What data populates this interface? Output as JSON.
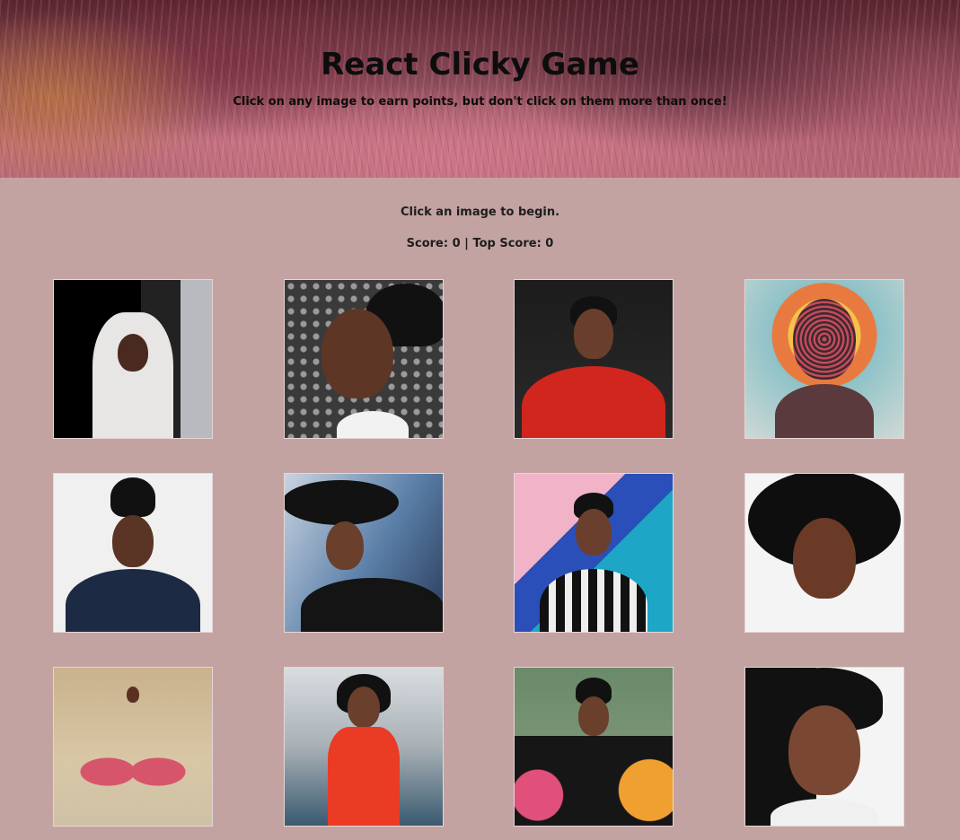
{
  "header": {
    "title": "React Clicky Game",
    "subtitle": "Click on any image to earn points, but don't click on them more than once!"
  },
  "status": {
    "message": "Click an image to begin.",
    "score_line": "Score: 0 | Top Score: 0"
  },
  "colors": {
    "page_background": "#c3a3a2",
    "text": "#1a1a1a"
  },
  "cards": [
    {
      "label": "white-dress-photo"
    },
    {
      "label": "close-up-portrait-photo"
    },
    {
      "label": "red-jacket-photo"
    },
    {
      "label": "beaded-veil-album-art"
    },
    {
      "label": "sunglasses-suit-photo"
    },
    {
      "label": "wide-brim-hat-photo"
    },
    {
      "label": "colorful-wall-photo"
    },
    {
      "label": "jeweled-cap-photo"
    },
    {
      "label": "desert-pink-dress-photo"
    },
    {
      "label": "red-coat-rocket-photo"
    },
    {
      "label": "muppets-photo"
    },
    {
      "label": "surprised-portrait-photo"
    }
  ]
}
